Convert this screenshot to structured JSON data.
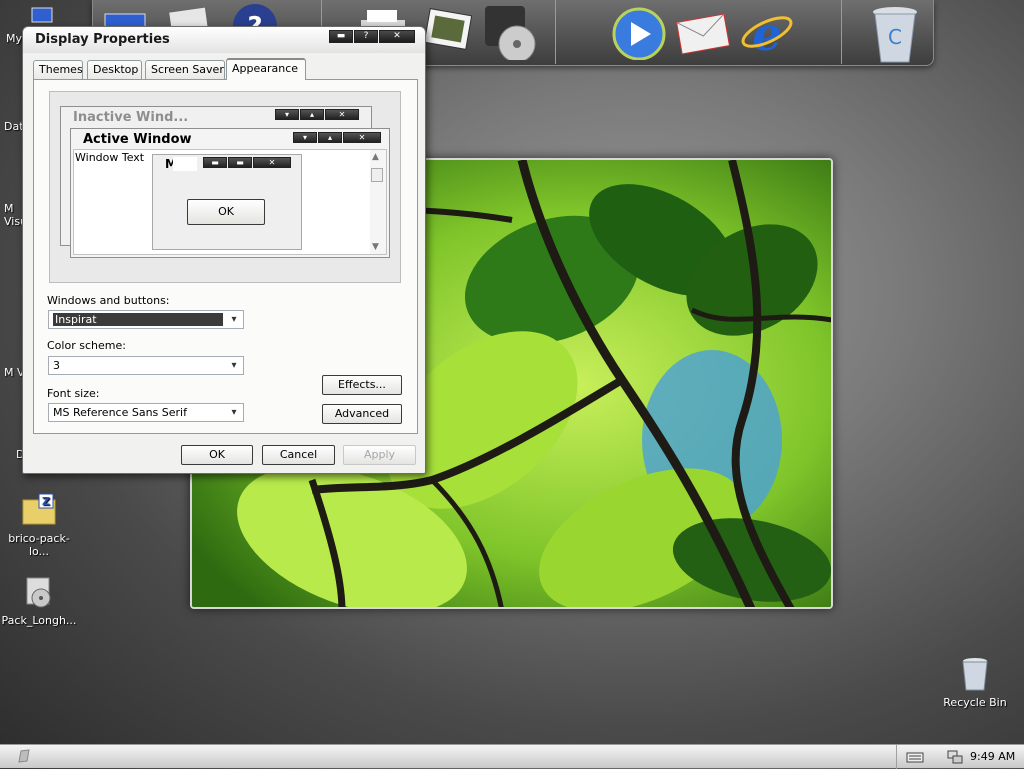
{
  "dialog": {
    "title": "Display Properties",
    "tabs": [
      "Themes",
      "Desktop",
      "Screen Saver",
      "Appearance"
    ],
    "active_tab": "Appearance",
    "preview": {
      "inactive_title": "Inactive Wind...",
      "active_title": "Active Window",
      "window_text": "Window Text",
      "msg_title": "M",
      "ok_label": "OK"
    },
    "windows_buttons_label": "Windows and buttons:",
    "windows_buttons_value": "Inspirat",
    "color_scheme_label": "Color scheme:",
    "color_scheme_value": "3",
    "font_size_label": "Font size:",
    "font_size_value": "MS Reference Sans Serif",
    "effects_label": "Effects...",
    "advanced_label": "Advanced",
    "ok_label": "OK",
    "cancel_label": "Cancel",
    "apply_label": "Apply"
  },
  "desktop_icons": [
    {
      "label": "My",
      "icon": "computer-icon"
    },
    {
      "label": "Data",
      "icon": "folder-icon"
    },
    {
      "label": "M Visu",
      "icon": "app-icon"
    },
    {
      "label": "M Vis",
      "icon": "app-icon"
    },
    {
      "label": "D",
      "icon": "app-icon"
    },
    {
      "label": "brico-pack-lo...",
      "icon": "zip-folder-icon"
    },
    {
      "label": "Pack_Longh...",
      "icon": "installer-icon"
    },
    {
      "label": "Recycle Bin",
      "icon": "recycle-bin-icon"
    }
  ],
  "taskbar": {
    "clock": "9:49 AM"
  },
  "colors": {
    "dialog_bg": "#f1f1ef",
    "selection": "#3b3b3b"
  }
}
